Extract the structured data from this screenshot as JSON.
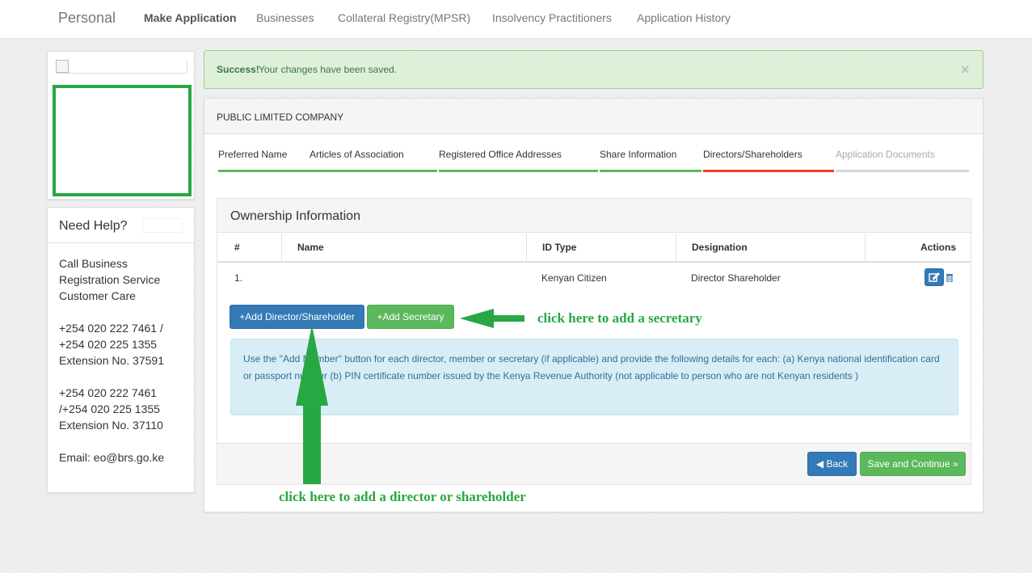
{
  "nav": {
    "brand": "Personal",
    "links": [
      "Make Application",
      "Businesses",
      "Collateral Registry(MPSR)",
      "Insolvency Practitioners",
      "Application History"
    ]
  },
  "help": {
    "title": "Need Help?",
    "lines": [
      "Call Business",
      "Registration Service",
      "Customer Care",
      "+254 020 222 7461 /",
      "+254 020 225 1355",
      "Extension No. 37591",
      "+254 020 222 7461",
      "/+254 020 225 1355",
      "Extension No. 37110",
      "Email: eo@brs.go.ke"
    ]
  },
  "alert": {
    "strong": "Success!",
    "text": "Your changes have been saved.",
    "close": "×"
  },
  "application": {
    "company_type": "PUBLIC LIMITED COMPANY",
    "steps": [
      {
        "label": "Preferred Name",
        "status": "complete"
      },
      {
        "label": "Articles of Association",
        "status": "complete"
      },
      {
        "label": "Registered Office Addresses",
        "status": "complete"
      },
      {
        "label": "Share Information",
        "status": "complete"
      },
      {
        "label": "Directors/Shareholders",
        "status": "current"
      },
      {
        "label": "Application Documents",
        "status": "pending"
      }
    ]
  },
  "ownership": {
    "title": "Ownership Information",
    "columns": [
      "#",
      "Name",
      "ID Type",
      "Designation",
      "Actions"
    ],
    "rows": [
      {
        "num": "1.",
        "name": "",
        "id_type": "Kenyan Citizen",
        "designation": "Director Shareholder"
      }
    ],
    "add_director_label": "Add Director/Shareholder",
    "add_secretary_label": "Add Secretary",
    "info_text": "Use the \"Add Member\" button for each director, member or secretary (if applicable) and provide the following details for each: (a) Kenya national identification card or passport number (b) PIN certificate number issued by the Kenya Revenue Authority (not applicable to person who are not Kenyan residents )",
    "back_label": "Back",
    "save_label": "Save and Continue"
  },
  "annotations": {
    "secretary": "click here to add a secretary",
    "director": "click here to add a director or shareholder"
  },
  "colors": {
    "complete": "#5cb85c",
    "current": "#e8431a",
    "pending": "#d6d6d6",
    "annotation": "#27a844",
    "primary": "#337ab7"
  },
  "icons": {
    "edit": "edit-icon",
    "delete": "trash-icon",
    "back": "circle-chevron-left-icon",
    "continue": "double-chevron-right-icon",
    "add": "plus-icon"
  }
}
